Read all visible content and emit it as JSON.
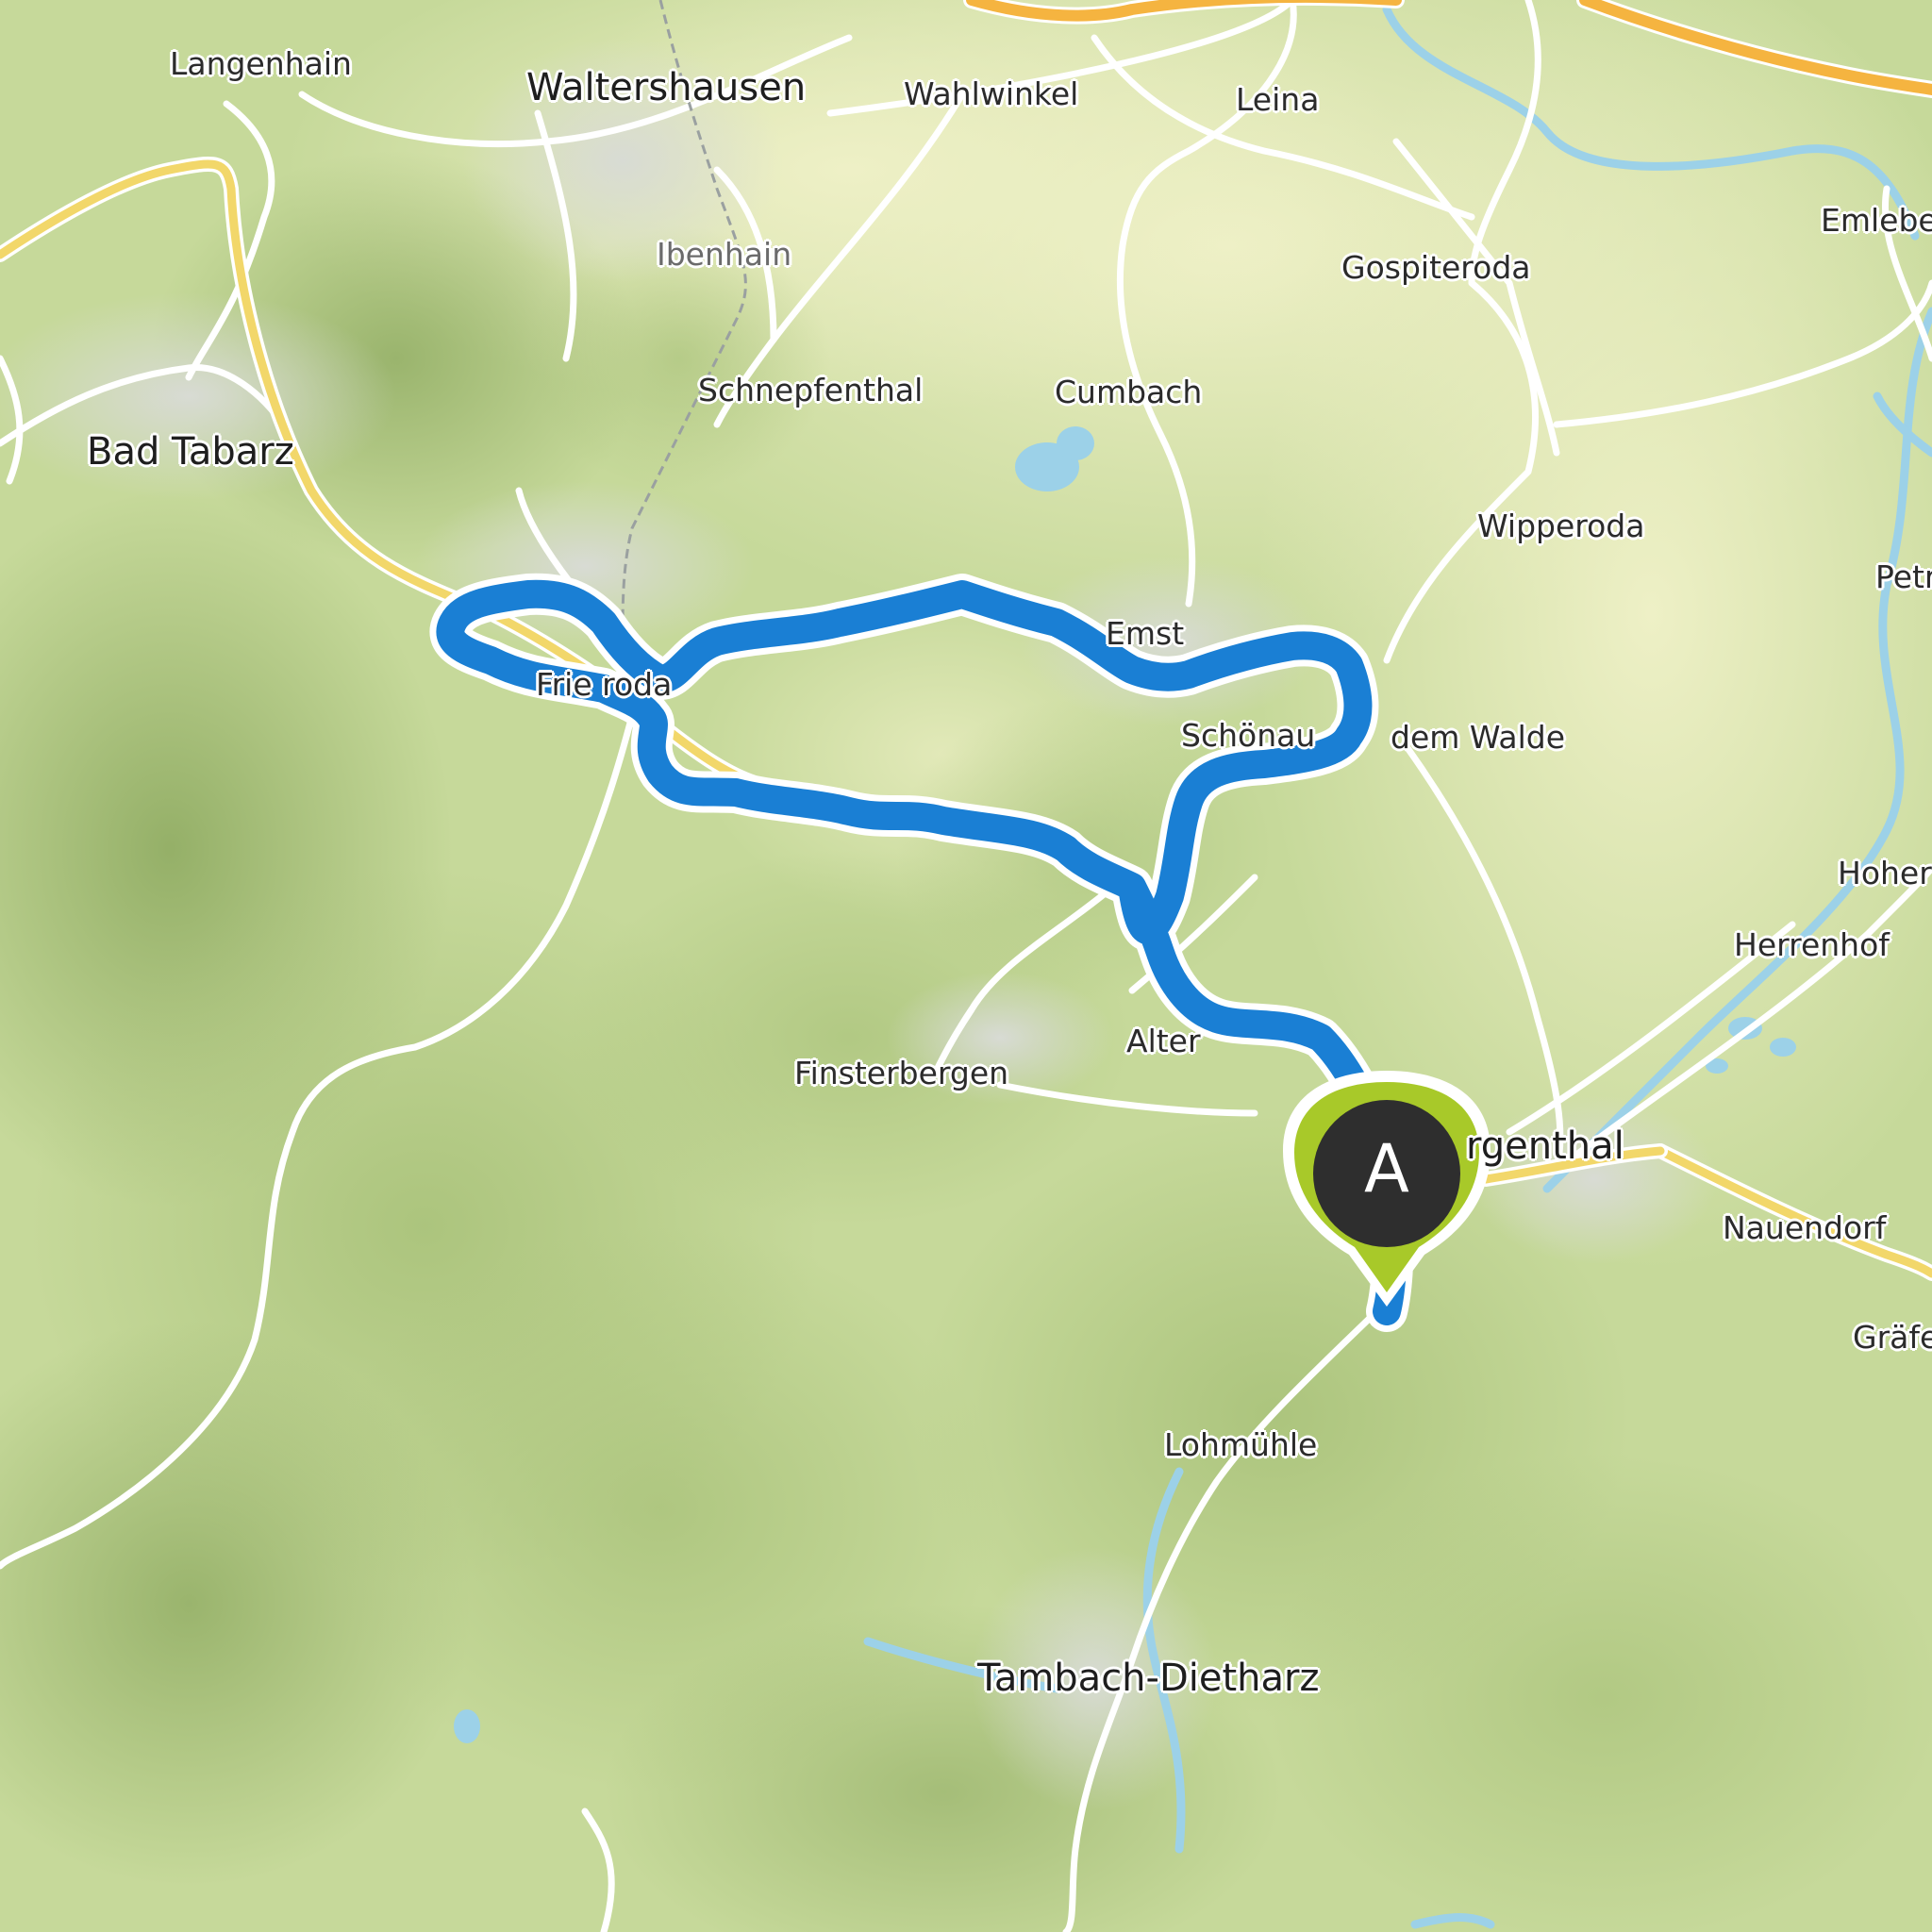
{
  "map": {
    "places": {
      "langenhain": "Langenhain",
      "waltershausen": "Waltershausen",
      "wahlwinkel": "Wahlwinkel",
      "leina": "Leina",
      "emleben": "Emlebe",
      "ibenhain": "Ibenhain",
      "gospiteroda": "Gospiteroda",
      "schnepfenthal": "Schnepfenthal",
      "cumbach": "Cumbach",
      "bad_tabarz": "Bad Tabarz",
      "wipperoda": "Wipperoda",
      "petriroda": "Petr",
      "emsetal": "Emst",
      "friedrichroda": "Frie       roda",
      "schoenau": "Schönau",
      "vor_dem_walde": "dem Walde",
      "hohenkirchen": "Hoher",
      "herrenhof": "Herrenhof",
      "altenbergen": "Alter",
      "finsterbergen": "Finsterbergen",
      "georgenthal": "rgenthal",
      "nauendorf": "Nauendorf",
      "graefenhain": "Gräfe",
      "lohmuehle": "Lohmühle",
      "tambach_dietharz": "Tambach-Dietharz"
    },
    "start_marker": {
      "letter": "A",
      "color": "#a8c929"
    },
    "route_color": "#1a7fd4"
  }
}
